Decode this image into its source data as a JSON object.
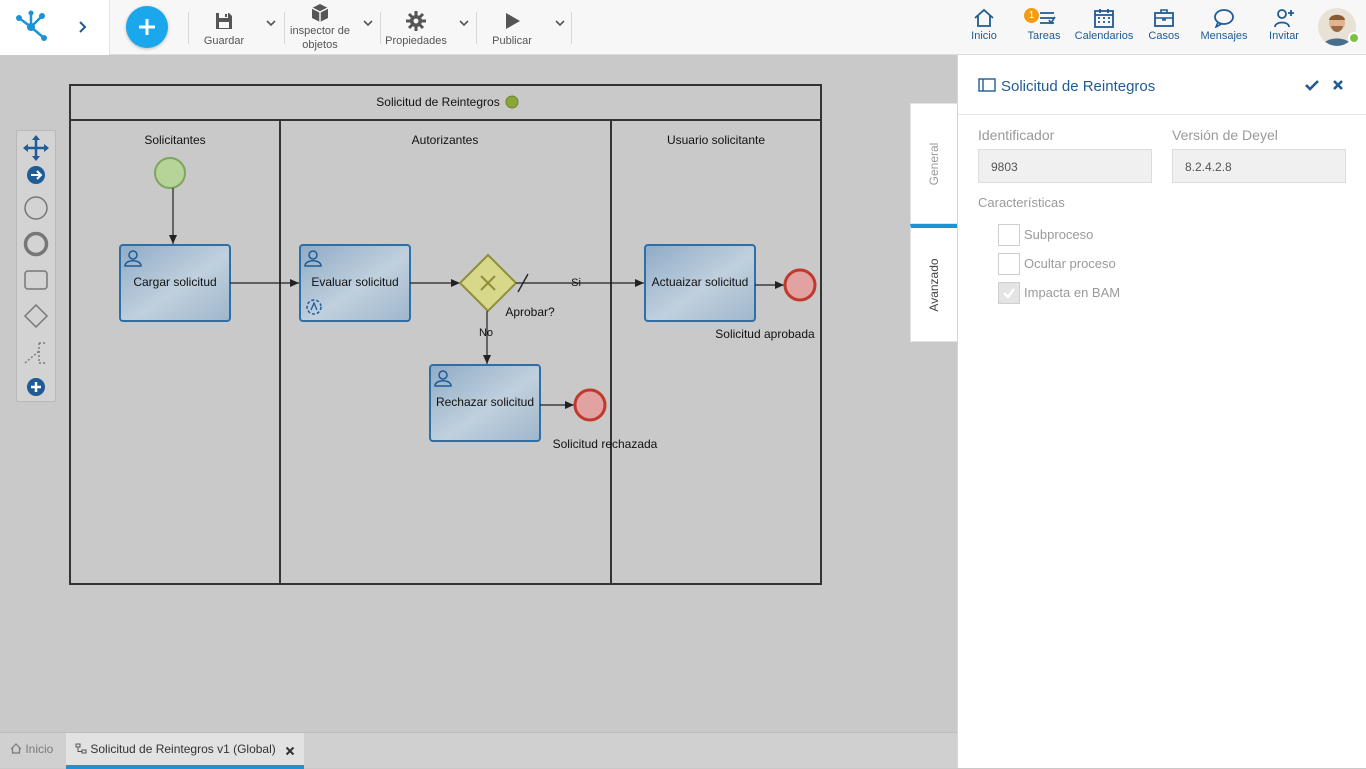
{
  "toolbar": {
    "save_label": "Guardar",
    "inspector_label": "inspector de objetos",
    "properties_label": "Propiedades",
    "publish_label": "Publicar"
  },
  "nav": {
    "home": "Inicio",
    "tasks": "Tareas",
    "tasks_badge": "1",
    "calendars": "Calendarios",
    "cases": "Casos",
    "messages": "Mensajes",
    "invite": "Invitar"
  },
  "diagram": {
    "pool_title": "Solicitud de Reintegros",
    "lanes": [
      "Solicitantes",
      "Autorizantes",
      "Usuario solicitante"
    ],
    "tasks": {
      "load_request": "Cargar solicitud",
      "evaluate_request": "Evaluar solicitud",
      "reject_request": "Rechazar solicitud",
      "update_request": "Actuaizar solicitud"
    },
    "gateway_label": "Aprobar?",
    "flow_yes": "Si",
    "flow_no": "No",
    "end_approved": "Solicitud aprobada",
    "end_rejected": "Solicitud rechazada"
  },
  "panel": {
    "title": "Solicitud de Reintegros",
    "id_label": "Identificador",
    "id_value": "9803",
    "version_label": "Versión de Deyel",
    "version_value": "8.2.4.2.8",
    "characteristics_label": "Características",
    "checkboxes": [
      {
        "label": "Subproceso",
        "checked": false
      },
      {
        "label": "Ocultar proceso",
        "checked": false
      },
      {
        "label": "Impacta en BAM",
        "checked": true
      }
    ],
    "tabs": [
      "General",
      "Avanzado"
    ]
  },
  "bottom_tabs": {
    "home": "Inicio",
    "process": "Solicitud de Reintegros v1 (Global)"
  },
  "colors": {
    "brand_blue": "#1f5b94",
    "accent_blue": "#1aa7ec",
    "task_fill": "#a6bdd1",
    "start_event": "#b6d39a",
    "end_event": "#e3a2a2",
    "gateway": "#d8d88a",
    "badge": "#f39c12",
    "status_green": "#7cc242"
  }
}
